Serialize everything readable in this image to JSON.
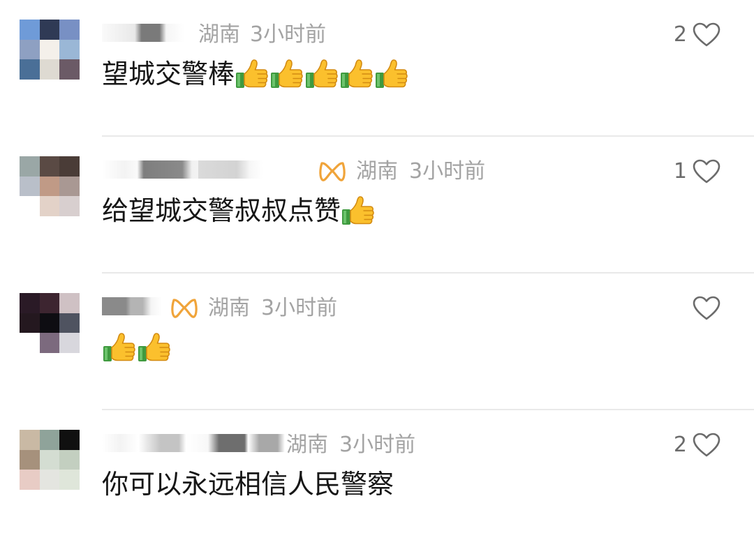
{
  "comments": [
    {
      "location": "湖南",
      "time": "3小时前",
      "likes": "2",
      "text": "望城交警棒",
      "thumbs": 5,
      "vip": false,
      "avatar_colors": [
        "#6f9bd8",
        "#2f3a55",
        "#7890c4",
        "#8ea0c2",
        "#f4f0ea",
        "#9ab7d6",
        "#4a6f97",
        "#dedad2",
        "#6b5a66"
      ]
    },
    {
      "location": "湖南",
      "time": "3小时前",
      "likes": "1",
      "text": "给望城交警叔叔点赞",
      "thumbs": 1,
      "vip": true,
      "avatar_colors": [
        "#9aa7a6",
        "#5a4a44",
        "#4a3c37",
        "#b9bfc9",
        "#c09a86",
        "#a99893",
        "#ffffff",
        "#e3d2c8",
        "#d8cfcf"
      ]
    },
    {
      "location": "湖南",
      "time": "3小时前",
      "likes": "",
      "text": "",
      "thumbs": 2,
      "vip": true,
      "avatar_colors": [
        "#2a1a26",
        "#3d2530",
        "#cfc1c4",
        "#24181f",
        "#0e0d12",
        "#4f5360",
        "#ffffff",
        "#7c6a7e",
        "#d8d7dd"
      ]
    },
    {
      "location": "湖南",
      "time": "3小时前",
      "likes": "2",
      "text": "你可以永远相信人民警察",
      "thumbs": 0,
      "vip": false,
      "avatar_colors": [
        "#c9b9a4",
        "#8fa39a",
        "#101010",
        "#a6917c",
        "#d4ddd2",
        "#c3cfc0",
        "#e8ccc5",
        "#e4e5e0",
        "#dfe6da"
      ]
    }
  ],
  "colors": {
    "meta_text": "#a3a3a3",
    "like_count": "#6b6b6b",
    "divider": "#e9e9e9",
    "vip_orange": "#f0a43a"
  },
  "icons": {
    "heart": "heart-outline-icon",
    "vip": "vip-badge-icon",
    "thumb": "thumbs-up-emoji-icon"
  }
}
